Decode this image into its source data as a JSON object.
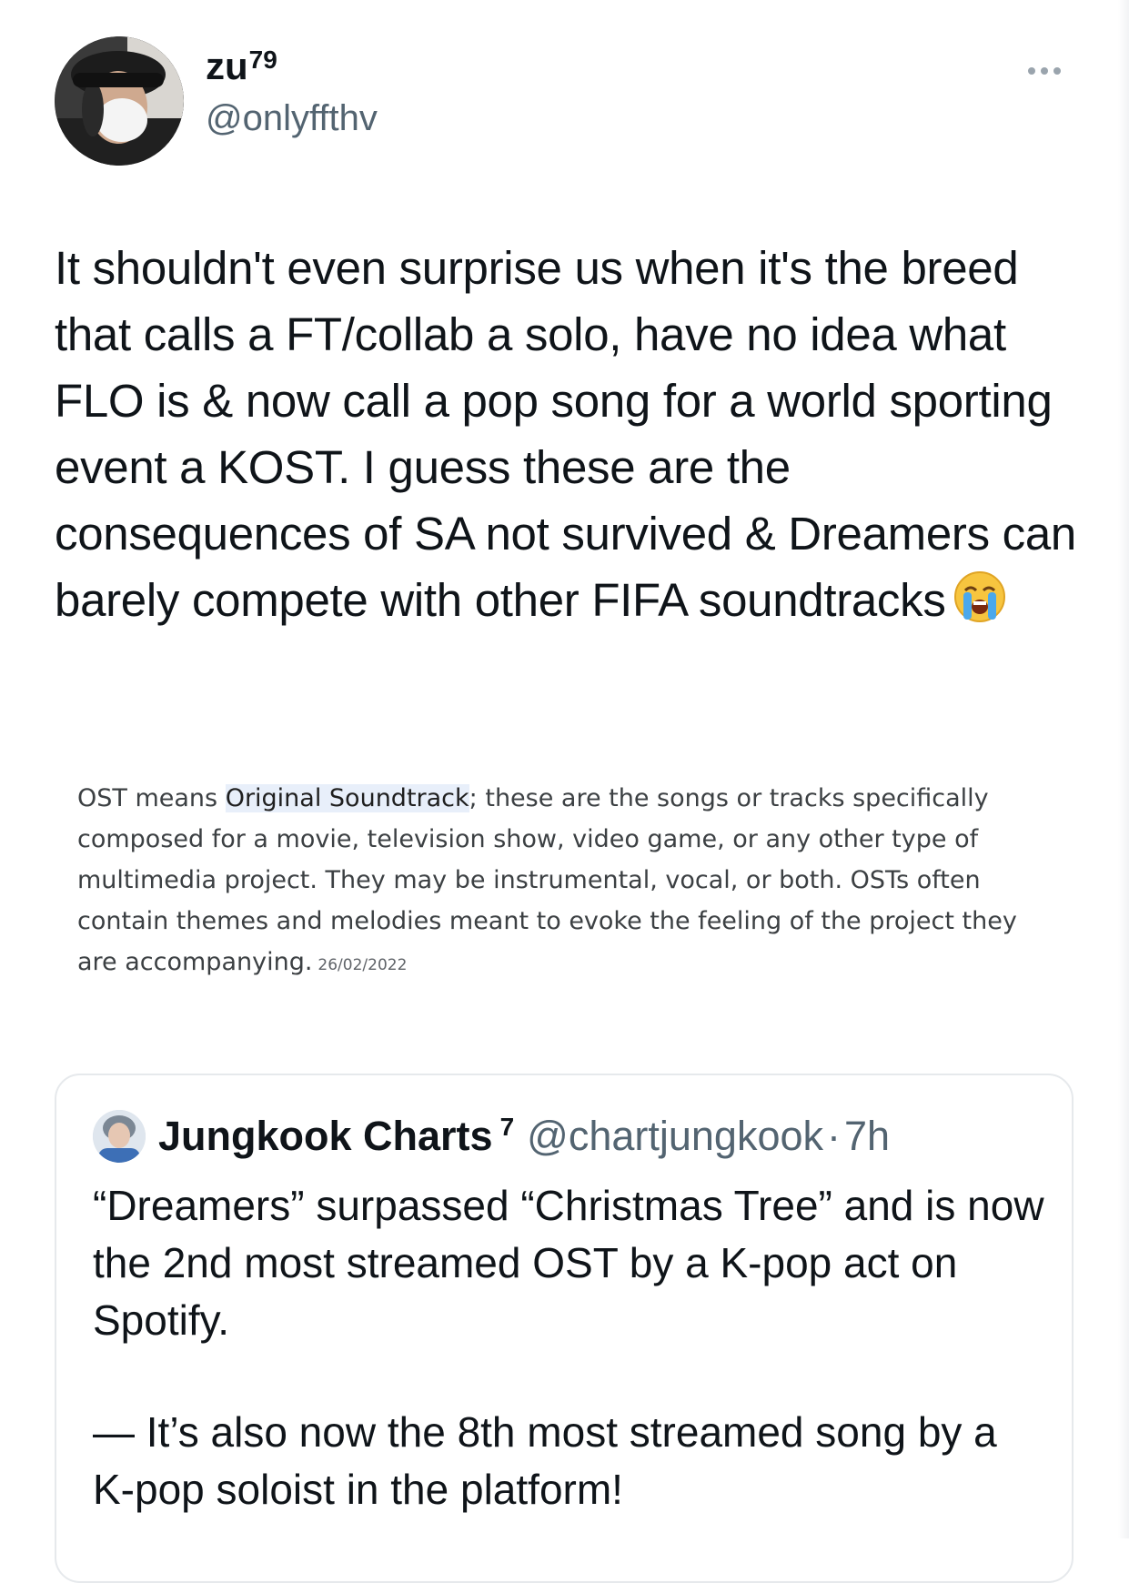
{
  "author": {
    "display_name": "zu",
    "display_name_sup": "79",
    "handle": "@onlyffthv"
  },
  "tweet": {
    "text": "It shouldn't even surprise us when it's the breed that calls a FT/collab a solo, have no idea what FLO is & now call a pop song for a world sporting event a KOST. I guess these are the consequences of SA not survived & Dreamers can barely compete with other FIFA soundtracks",
    "emoji_icon": "loudly-crying-face-emoji"
  },
  "definition": {
    "before": "OST means ",
    "highlight": "Original Soundtrack",
    "after": "; these are the songs or tracks specifically composed for a movie, television show, video game, or any other type of multimedia project. They may be instrumental, vocal, or both. OSTs often contain themes and melodies meant to evoke the feeling of the project they are accompanying.",
    "date": "26/02/2022"
  },
  "quote": {
    "display_name": "Jungkook Charts",
    "display_name_sup": "7",
    "handle": "@chartjungkook",
    "separator": "·",
    "time": "7h",
    "paragraph1": "“Dreamers” surpassed “Christmas Tree” and is now the 2nd most streamed OST by a K-pop act on Spotify.",
    "paragraph2": "— It’s also now the 8th most streamed song by a K-pop soloist in the platform!"
  },
  "colors": {
    "text_primary": "#0f1419",
    "text_secondary": "#536471",
    "highlight_bg": "#e8effa",
    "card_border": "#e6e9ec"
  }
}
